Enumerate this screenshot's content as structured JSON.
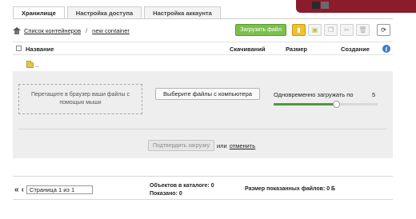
{
  "tabs": [
    {
      "label": "Хранилище",
      "active": true
    },
    {
      "label": "Настройка доступа",
      "active": false
    },
    {
      "label": "Настройка аккаунта",
      "active": false
    }
  ],
  "breadcrumb": {
    "root": "Список контейнеров",
    "separator": "/",
    "current": "new container"
  },
  "toolbar": {
    "upload_label": "Загрузить файл"
  },
  "table": {
    "col_name": "Название",
    "col_downloads": "Скачиваний",
    "col_size": "Размер",
    "col_created": "Создание",
    "parent_dir": ".."
  },
  "upload": {
    "dropzone_text": "Перетащите в браузер ваши файлы с помощью мыши",
    "choose_label": "Выберите файлы с компьютера",
    "concurrent_label": "Одновременно загружать по",
    "concurrent_value": "5",
    "slider_level_fraction": 0.6,
    "confirm_label": "Подтвердить загрузку",
    "or_text": "или",
    "cancel_label": "отменить"
  },
  "footer": {
    "page_text": "Страница 1 из 1",
    "objects_text": "Объектов в каталоге: 0",
    "shown_text": "Показано: 0",
    "shown_size_text": "Размер показанных файлов: 0 Б"
  },
  "colors": {
    "accent_green": "#7cc04c",
    "slider_fill": "#4e9a3a",
    "info_blue": "#3d7fc4",
    "header_bar": "#8a1c2c"
  },
  "icons": [
    "home-icon",
    "folder-up-icon",
    "info-icon",
    "refresh-icon",
    "new-folder-icon",
    "copy-icon",
    "cut-icon",
    "delete-icon",
    "archive-icon"
  ]
}
